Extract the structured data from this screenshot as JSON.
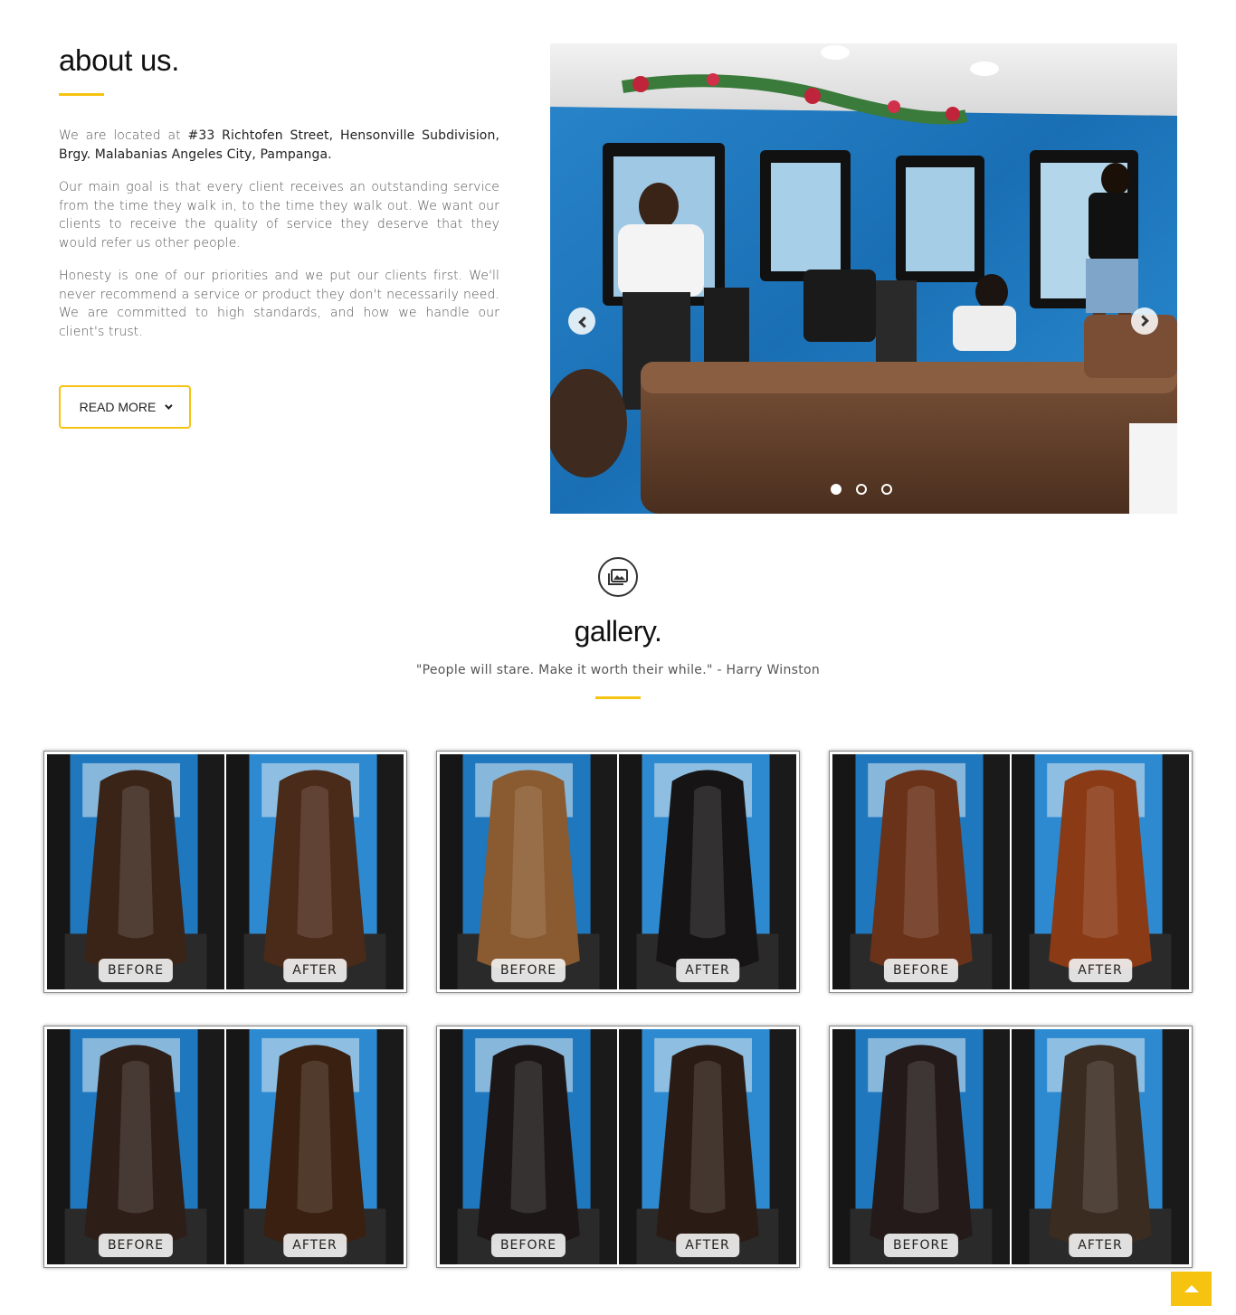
{
  "about": {
    "title": "about us.",
    "p1_lead": "We are located at ",
    "p1_address": "#33 Richtofen Street, Hensonville Subdivision, Brgy. Malabanias Angeles City, Pampanga.",
    "p2": "Our main goal is that every client receives an outstanding service from the time they walk in, to the time they walk out. We want our clients to receive the quality of service they deserve that they would refer us other people.",
    "p3": "Honesty is one of our priorities and we put our clients first. We'll never recommend a service or product they don't necessarily need. We are committed to high standards, and how we handle our client's trust.",
    "read_more": "READ MORE"
  },
  "carousel": {
    "slide_count": 3,
    "active_slide": 1
  },
  "gallery": {
    "title": "gallery.",
    "quote": "\"People will stare. Make it worth their while.\" - Harry Winston",
    "cards": [
      {
        "before_label": "BEFORE",
        "after_label": "AFTER",
        "before_hair": "#3a2418",
        "after_hair": "#4a2a18"
      },
      {
        "before_label": "BEFORE",
        "after_label": "AFTER",
        "before_hair": "#8a5a30",
        "after_hair": "#161414"
      },
      {
        "before_label": "BEFORE",
        "after_label": "AFTER",
        "before_hair": "#6a3218",
        "after_hair": "#8a3a14"
      },
      {
        "before_label": "BEFORE",
        "after_label": "AFTER",
        "before_hair": "#2e1e18",
        "after_hair": "#3a2010"
      },
      {
        "before_label": "BEFORE",
        "after_label": "AFTER",
        "before_hair": "#1c1616",
        "after_hair": "#2a1c14"
      },
      {
        "before_label": "BEFORE",
        "after_label": "AFTER",
        "before_hair": "#241a1a",
        "after_hair": "#3a2c20"
      }
    ]
  },
  "colors": {
    "accent": "#f5c310",
    "salon_wall": "#1f7fc4"
  },
  "icons": {
    "gallery": "photo-gallery-icon",
    "prev": "chevron-left-icon",
    "next": "chevron-right-icon",
    "top": "arrow-up-icon"
  }
}
